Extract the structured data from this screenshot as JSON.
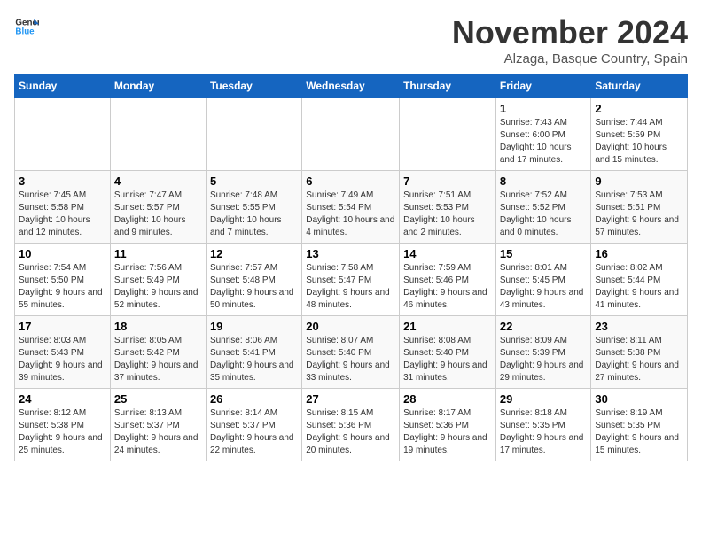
{
  "header": {
    "logo_general": "General",
    "logo_blue": "Blue",
    "month": "November 2024",
    "location": "Alzaga, Basque Country, Spain"
  },
  "weekdays": [
    "Sunday",
    "Monday",
    "Tuesday",
    "Wednesday",
    "Thursday",
    "Friday",
    "Saturday"
  ],
  "weeks": [
    [
      {
        "day": "",
        "sunrise": "",
        "sunset": "",
        "daylight": ""
      },
      {
        "day": "",
        "sunrise": "",
        "sunset": "",
        "daylight": ""
      },
      {
        "day": "",
        "sunrise": "",
        "sunset": "",
        "daylight": ""
      },
      {
        "day": "",
        "sunrise": "",
        "sunset": "",
        "daylight": ""
      },
      {
        "day": "",
        "sunrise": "",
        "sunset": "",
        "daylight": ""
      },
      {
        "day": "1",
        "sunrise": "Sunrise: 7:43 AM",
        "sunset": "Sunset: 6:00 PM",
        "daylight": "Daylight: 10 hours and 17 minutes."
      },
      {
        "day": "2",
        "sunrise": "Sunrise: 7:44 AM",
        "sunset": "Sunset: 5:59 PM",
        "daylight": "Daylight: 10 hours and 15 minutes."
      }
    ],
    [
      {
        "day": "3",
        "sunrise": "Sunrise: 7:45 AM",
        "sunset": "Sunset: 5:58 PM",
        "daylight": "Daylight: 10 hours and 12 minutes."
      },
      {
        "day": "4",
        "sunrise": "Sunrise: 7:47 AM",
        "sunset": "Sunset: 5:57 PM",
        "daylight": "Daylight: 10 hours and 9 minutes."
      },
      {
        "day": "5",
        "sunrise": "Sunrise: 7:48 AM",
        "sunset": "Sunset: 5:55 PM",
        "daylight": "Daylight: 10 hours and 7 minutes."
      },
      {
        "day": "6",
        "sunrise": "Sunrise: 7:49 AM",
        "sunset": "Sunset: 5:54 PM",
        "daylight": "Daylight: 10 hours and 4 minutes."
      },
      {
        "day": "7",
        "sunrise": "Sunrise: 7:51 AM",
        "sunset": "Sunset: 5:53 PM",
        "daylight": "Daylight: 10 hours and 2 minutes."
      },
      {
        "day": "8",
        "sunrise": "Sunrise: 7:52 AM",
        "sunset": "Sunset: 5:52 PM",
        "daylight": "Daylight: 10 hours and 0 minutes."
      },
      {
        "day": "9",
        "sunrise": "Sunrise: 7:53 AM",
        "sunset": "Sunset: 5:51 PM",
        "daylight": "Daylight: 9 hours and 57 minutes."
      }
    ],
    [
      {
        "day": "10",
        "sunrise": "Sunrise: 7:54 AM",
        "sunset": "Sunset: 5:50 PM",
        "daylight": "Daylight: 9 hours and 55 minutes."
      },
      {
        "day": "11",
        "sunrise": "Sunrise: 7:56 AM",
        "sunset": "Sunset: 5:49 PM",
        "daylight": "Daylight: 9 hours and 52 minutes."
      },
      {
        "day": "12",
        "sunrise": "Sunrise: 7:57 AM",
        "sunset": "Sunset: 5:48 PM",
        "daylight": "Daylight: 9 hours and 50 minutes."
      },
      {
        "day": "13",
        "sunrise": "Sunrise: 7:58 AM",
        "sunset": "Sunset: 5:47 PM",
        "daylight": "Daylight: 9 hours and 48 minutes."
      },
      {
        "day": "14",
        "sunrise": "Sunrise: 7:59 AM",
        "sunset": "Sunset: 5:46 PM",
        "daylight": "Daylight: 9 hours and 46 minutes."
      },
      {
        "day": "15",
        "sunrise": "Sunrise: 8:01 AM",
        "sunset": "Sunset: 5:45 PM",
        "daylight": "Daylight: 9 hours and 43 minutes."
      },
      {
        "day": "16",
        "sunrise": "Sunrise: 8:02 AM",
        "sunset": "Sunset: 5:44 PM",
        "daylight": "Daylight: 9 hours and 41 minutes."
      }
    ],
    [
      {
        "day": "17",
        "sunrise": "Sunrise: 8:03 AM",
        "sunset": "Sunset: 5:43 PM",
        "daylight": "Daylight: 9 hours and 39 minutes."
      },
      {
        "day": "18",
        "sunrise": "Sunrise: 8:05 AM",
        "sunset": "Sunset: 5:42 PM",
        "daylight": "Daylight: 9 hours and 37 minutes."
      },
      {
        "day": "19",
        "sunrise": "Sunrise: 8:06 AM",
        "sunset": "Sunset: 5:41 PM",
        "daylight": "Daylight: 9 hours and 35 minutes."
      },
      {
        "day": "20",
        "sunrise": "Sunrise: 8:07 AM",
        "sunset": "Sunset: 5:40 PM",
        "daylight": "Daylight: 9 hours and 33 minutes."
      },
      {
        "day": "21",
        "sunrise": "Sunrise: 8:08 AM",
        "sunset": "Sunset: 5:40 PM",
        "daylight": "Daylight: 9 hours and 31 minutes."
      },
      {
        "day": "22",
        "sunrise": "Sunrise: 8:09 AM",
        "sunset": "Sunset: 5:39 PM",
        "daylight": "Daylight: 9 hours and 29 minutes."
      },
      {
        "day": "23",
        "sunrise": "Sunrise: 8:11 AM",
        "sunset": "Sunset: 5:38 PM",
        "daylight": "Daylight: 9 hours and 27 minutes."
      }
    ],
    [
      {
        "day": "24",
        "sunrise": "Sunrise: 8:12 AM",
        "sunset": "Sunset: 5:38 PM",
        "daylight": "Daylight: 9 hours and 25 minutes."
      },
      {
        "day": "25",
        "sunrise": "Sunrise: 8:13 AM",
        "sunset": "Sunset: 5:37 PM",
        "daylight": "Daylight: 9 hours and 24 minutes."
      },
      {
        "day": "26",
        "sunrise": "Sunrise: 8:14 AM",
        "sunset": "Sunset: 5:37 PM",
        "daylight": "Daylight: 9 hours and 22 minutes."
      },
      {
        "day": "27",
        "sunrise": "Sunrise: 8:15 AM",
        "sunset": "Sunset: 5:36 PM",
        "daylight": "Daylight: 9 hours and 20 minutes."
      },
      {
        "day": "28",
        "sunrise": "Sunrise: 8:17 AM",
        "sunset": "Sunset: 5:36 PM",
        "daylight": "Daylight: 9 hours and 19 minutes."
      },
      {
        "day": "29",
        "sunrise": "Sunrise: 8:18 AM",
        "sunset": "Sunset: 5:35 PM",
        "daylight": "Daylight: 9 hours and 17 minutes."
      },
      {
        "day": "30",
        "sunrise": "Sunrise: 8:19 AM",
        "sunset": "Sunset: 5:35 PM",
        "daylight": "Daylight: 9 hours and 15 minutes."
      }
    ]
  ]
}
